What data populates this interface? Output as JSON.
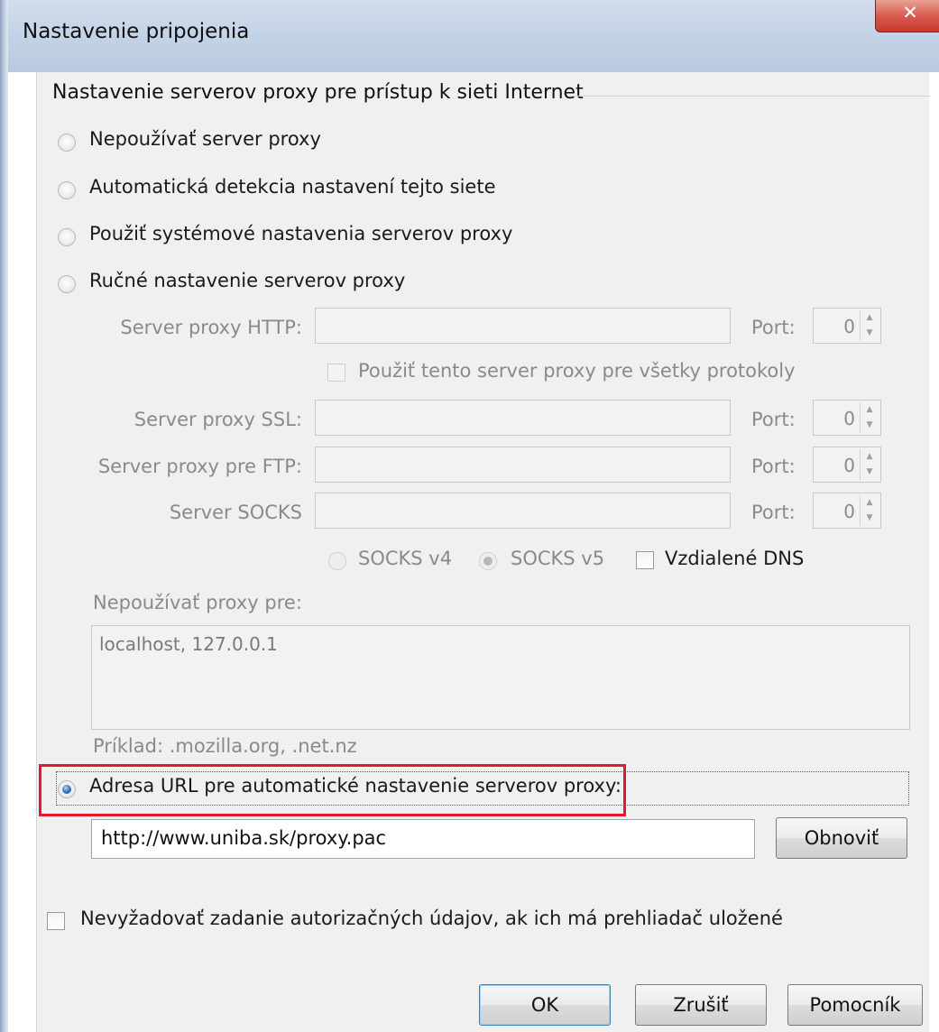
{
  "window": {
    "title": "Nastavenie pripojenia"
  },
  "group": {
    "title": "Nastavenie serverov proxy pre prístup k sieti Internet"
  },
  "options": {
    "no_proxy": "Nepoužívať server proxy",
    "auto_detect": "Automatická detekcia nastavení tejto siete",
    "system": "Použiť systémové nastavenia serverov proxy",
    "manual": "Ručné nastavenie serverov proxy",
    "auto_url": "Adresa URL pre automatické nastavenie serverov proxy:"
  },
  "selected_option": "auto_url",
  "manual": {
    "http_label": "Server proxy HTTP:",
    "share_label": "Použiť tento server proxy pre všetky protokoly",
    "ssl_label": "Server proxy SSL:",
    "ftp_label": "Server proxy pre FTP:",
    "socks_label": "Server SOCKS",
    "port_label": "Port:",
    "http_port": "0",
    "ssl_port": "0",
    "ftp_port": "0",
    "socks_port": "0",
    "socks_v4": "SOCKS v4",
    "socks_v5": "SOCKS v5",
    "remote_dns": "Vzdialené DNS",
    "no_proxy_for_label": "Nepoužívať proxy pre:",
    "no_proxy_for_value": "localhost, 127.0.0.1",
    "example": "Príklad: .mozilla.org, .net.nz"
  },
  "auto_url": {
    "value": "http://www.uniba.sk/proxy.pac",
    "reload_label": "Obnoviť"
  },
  "auth_checkbox_label": "Nevyžadovať zadanie autorizačných údajov, ak ich má prehliadač uložené",
  "buttons": {
    "ok": "OK",
    "cancel": "Zrušiť",
    "help": "Pomocník"
  },
  "colors": {
    "highlight": "#e4192e",
    "dialog_bg": "#f0f0f0",
    "disabled_text": "#8a8a8a"
  }
}
